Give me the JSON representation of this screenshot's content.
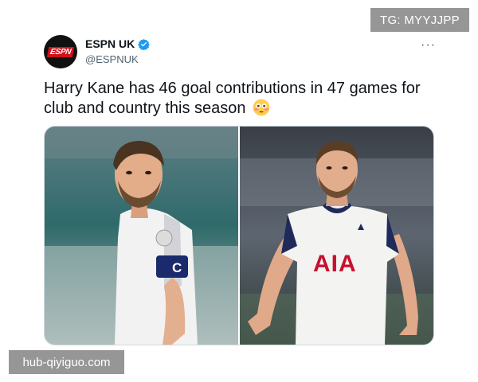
{
  "overlay": {
    "top_right_text": "TG: MYYJJPP",
    "bottom_left_text": "hub-qiyiguo.com"
  },
  "tweet": {
    "author": {
      "display_name": "ESPN UK",
      "handle": "@ESPNUK",
      "avatar_text": "ESPN",
      "verified": true
    },
    "text": "Harry Kane has 46 goal contributions in 47 games for club and country this season",
    "emoji": "flushed-face",
    "more_icon": "more-icon",
    "media": [
      {
        "kind": "photo",
        "subject": "England player with captain armband"
      },
      {
        "kind": "photo",
        "subject": "Tottenham player celebrating"
      }
    ],
    "photo_text": {
      "armband_letter": "C",
      "sponsor": "AIA"
    }
  },
  "colors": {
    "verified": "#1d9bf0",
    "espn_red": "#d0101a",
    "handle_gray": "#536471",
    "watermark_bg": "#787878"
  }
}
